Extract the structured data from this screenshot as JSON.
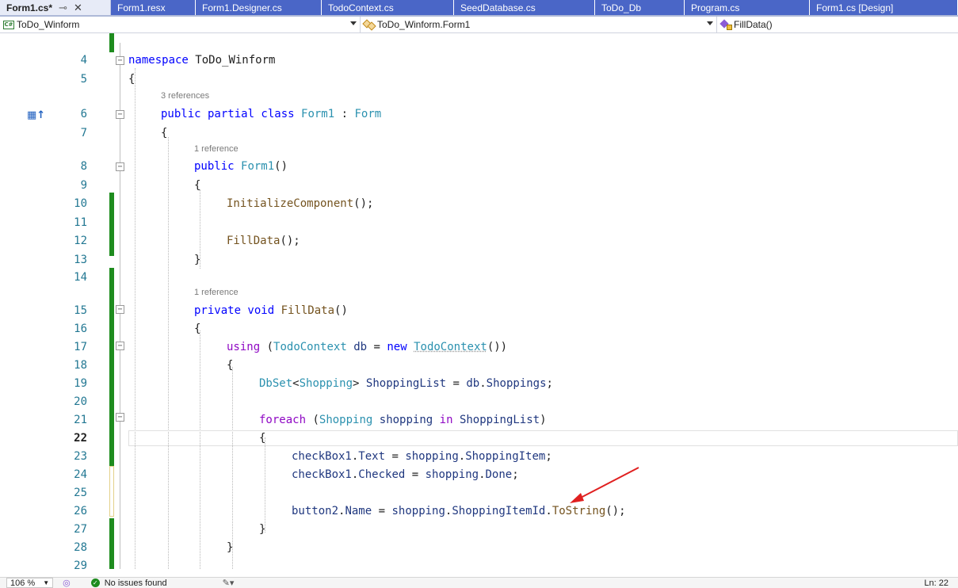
{
  "tabs": [
    {
      "label": "Form1.cs*",
      "active": true,
      "width": 140
    },
    {
      "label": "Form1.resx",
      "width": 107
    },
    {
      "label": "Form1.Designer.cs",
      "width": 159
    },
    {
      "label": "TodoContext.cs",
      "width": 167
    },
    {
      "label": "SeedDatabase.cs",
      "width": 178
    },
    {
      "label": "ToDo_Db",
      "width": 113
    },
    {
      "label": "Program.cs",
      "width": 158
    },
    {
      "label": "Form1.cs [Design]",
      "width": 187
    }
  ],
  "navbar": {
    "project": "ToDo_Winform",
    "class": "ToDo_Winform.Form1",
    "member": "FillData()"
  },
  "code": {
    "lines": [
      {
        "n": "4",
        "code": "namespace ToDo_Winform"
      },
      {
        "n": "5",
        "code": "{"
      },
      {
        "lens": "3 references"
      },
      {
        "n": "6",
        "code": "public partial class Form1 : Form"
      },
      {
        "n": "7",
        "code": "{"
      },
      {
        "lens": "1 reference"
      },
      {
        "n": "8",
        "code": "public Form1()"
      },
      {
        "n": "9",
        "code": "{"
      },
      {
        "n": "10",
        "code": "InitializeComponent();"
      },
      {
        "n": "11",
        "code": ""
      },
      {
        "n": "12",
        "code": "FillData();"
      },
      {
        "n": "13",
        "code": "}"
      },
      {
        "n": "14",
        "code": ""
      },
      {
        "lens": "1 reference"
      },
      {
        "n": "15",
        "code": "private void FillData()"
      },
      {
        "n": "16",
        "code": "{"
      },
      {
        "n": "17",
        "code": "using (TodoContext db = new TodoContext())"
      },
      {
        "n": "18",
        "code": "{"
      },
      {
        "n": "19",
        "code": "DbSet<Shopping> ShoppingList = db.Shoppings;"
      },
      {
        "n": "20",
        "code": ""
      },
      {
        "n": "21",
        "code": "foreach (Shopping shopping in ShoppingList)"
      },
      {
        "n": "22",
        "code": "{"
      },
      {
        "n": "23",
        "code": "checkBox1.Text = shopping.ShoppingItem;"
      },
      {
        "n": "24",
        "code": "checkBox1.Checked = shopping.Done;"
      },
      {
        "n": "25",
        "code": ""
      },
      {
        "n": "26",
        "code": "button2.Name = shopping.ShoppingItemId.ToString();"
      },
      {
        "n": "27",
        "code": "}"
      },
      {
        "n": "28",
        "code": "}"
      },
      {
        "n": "29",
        "code": ""
      }
    ]
  },
  "status": {
    "zoom": "106 %",
    "issues": "No issues found",
    "position": "Ln: 22"
  },
  "colors": {
    "tab_bg": "#4a66c7",
    "keyword": "#0000ff",
    "control_keyword": "#8f08c4",
    "type": "#2b91af",
    "method": "#74531f",
    "line_number": "#237893",
    "change_marker": "#1e8c1e",
    "arrow": "#e02020"
  }
}
